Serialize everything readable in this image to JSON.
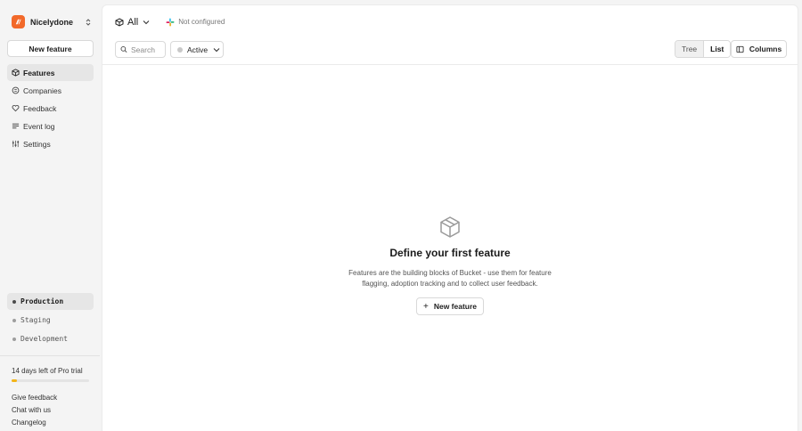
{
  "org": {
    "name": "Nicelydone",
    "logo_color": "#f2692a"
  },
  "sidebar": {
    "new_feature_label": "New feature",
    "nav": [
      {
        "label": "Features",
        "icon": "cube-icon",
        "active": true
      },
      {
        "label": "Companies",
        "icon": "building-icon"
      },
      {
        "label": "Feedback",
        "icon": "heart-icon"
      },
      {
        "label": "Event log",
        "icon": "list-icon"
      },
      {
        "label": "Settings",
        "icon": "sliders-icon"
      }
    ],
    "environments": [
      {
        "label": "Production",
        "active": true
      },
      {
        "label": "Staging"
      },
      {
        "label": "Development"
      }
    ],
    "trial": {
      "text": "14 days left of Pro trial",
      "progress_fraction": 0.07,
      "bar_color": "#f3b519"
    },
    "footer_links": [
      "Give feedback",
      "Chat with us",
      "Changelog"
    ]
  },
  "header": {
    "scope_label": "All",
    "integration_status": "Not configured"
  },
  "toolbar": {
    "search_placeholder": "Search",
    "status_filter_label": "Active",
    "view_options": [
      "Tree",
      "List"
    ],
    "active_view": "List",
    "columns_label": "Columns"
  },
  "empty_state": {
    "title": "Define your first feature",
    "description": "Features are the building blocks of Bucket - use them for feature flagging, adoption tracking and to collect user feedback.",
    "button_label": "New feature"
  }
}
